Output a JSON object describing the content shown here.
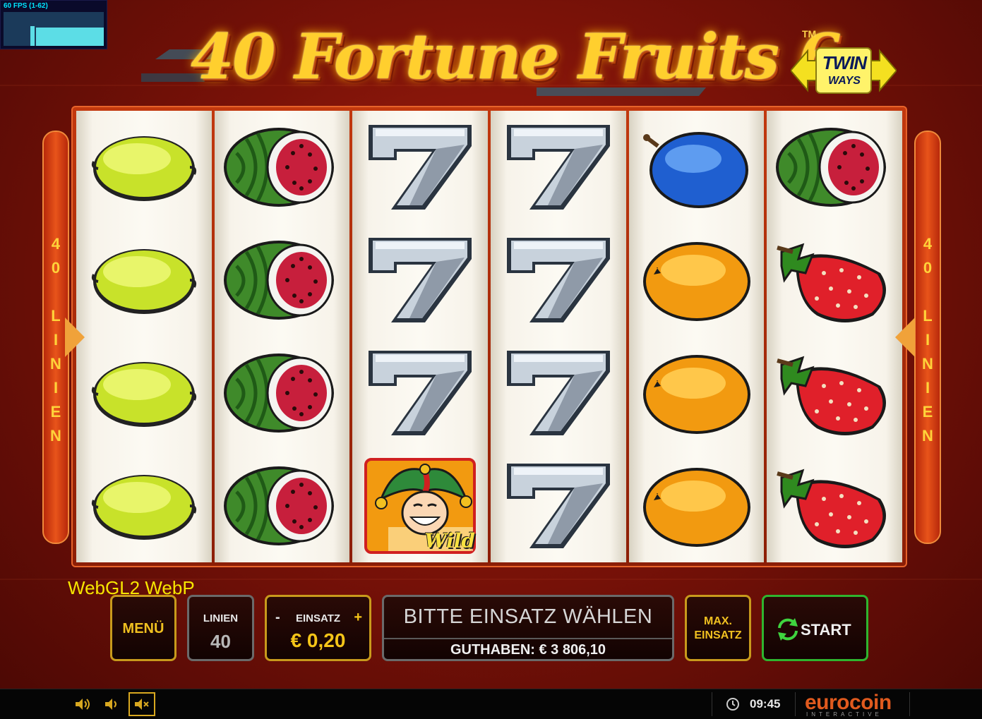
{
  "fps": {
    "label": "60 FPS (1-62)"
  },
  "title": {
    "text": "40 Fortune Fruits 6",
    "trademark": "TM",
    "badge_line1": "TWIN",
    "badge_line2": "WAYS"
  },
  "side_left": {
    "number_lines": [
      "4",
      "0"
    ],
    "word": [
      "L",
      "I",
      "N",
      "I",
      "E",
      "N"
    ]
  },
  "side_right": {
    "number_lines": [
      "4",
      "0"
    ],
    "word": [
      "L",
      "I",
      "N",
      "I",
      "E",
      "N"
    ]
  },
  "reels": [
    [
      "lemon-icon",
      "lemon-icon",
      "lemon-icon",
      "lemon-icon"
    ],
    [
      "watermelon-icon",
      "watermelon-icon",
      "watermelon-icon",
      "watermelon-icon"
    ],
    [
      "seven-icon",
      "seven-icon",
      "seven-icon",
      "joker-wild-icon"
    ],
    [
      "seven-icon",
      "seven-icon",
      "seven-icon",
      "seven-icon"
    ],
    [
      "plum-icon",
      "orange-icon",
      "orange-icon",
      "orange-icon"
    ],
    [
      "watermelon-icon",
      "strawberry-icon",
      "strawberry-icon",
      "strawberry-icon"
    ]
  ],
  "wild_label": "Wild",
  "render_info": "WebGL2  WebP",
  "controls": {
    "menu_label": "MENÜ",
    "lines_label": "LINIEN",
    "lines_value": "40",
    "bet_label": "EINSATZ",
    "bet_minus": "-",
    "bet_plus": "+",
    "bet_value": "€ 0,20",
    "message": "BITTE EINSATZ WÄHLEN",
    "balance": "GUTHABEN: € 3 806,10",
    "maxbet_line1": "MAX.",
    "maxbet_line2": "EINSATZ",
    "start_label": "START"
  },
  "sysbar": {
    "clock": "09:45",
    "brand": "eurocoin",
    "brand_sub": "INTERACTIVE"
  },
  "colors": {
    "gold": "#f0c020",
    "start_green": "#2fb52f",
    "brand_orange": "#e05a1e"
  }
}
